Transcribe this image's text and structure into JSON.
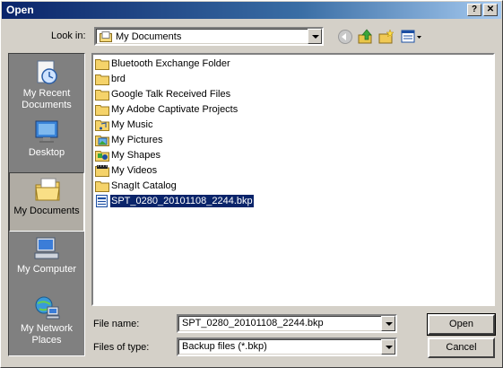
{
  "window": {
    "title": "Open",
    "help_label": "?",
    "close_label": "✕"
  },
  "toolbar": {
    "look_in_label": "Look in:",
    "look_in_value": "My Documents",
    "icons": [
      "back-icon",
      "up-folder-icon",
      "new-folder-icon",
      "view-menu-icon"
    ]
  },
  "places": [
    {
      "label": "My Recent Documents",
      "icon": "recent-documents-icon"
    },
    {
      "label": "Desktop",
      "icon": "desktop-icon"
    },
    {
      "label": "My Documents",
      "icon": "my-documents-icon",
      "selected": true
    },
    {
      "label": "My Computer",
      "icon": "my-computer-icon"
    },
    {
      "label": "My Network Places",
      "icon": "network-places-icon"
    }
  ],
  "files": [
    {
      "name": "Bluetooth Exchange Folder",
      "icon": "folder-icon"
    },
    {
      "name": "brd",
      "icon": "folder-icon"
    },
    {
      "name": "Google Talk Received Files",
      "icon": "folder-icon"
    },
    {
      "name": "My Adobe Captivate Projects",
      "icon": "folder-icon"
    },
    {
      "name": "My Music",
      "icon": "music-folder-icon"
    },
    {
      "name": "My Pictures",
      "icon": "pictures-folder-icon"
    },
    {
      "name": "My Shapes",
      "icon": "shapes-folder-icon"
    },
    {
      "name": "My Videos",
      "icon": "videos-folder-icon"
    },
    {
      "name": "SnagIt Catalog",
      "icon": "folder-icon"
    },
    {
      "name": "SPT_0280_20101108_2244.bkp",
      "icon": "file-icon",
      "selected": true
    }
  ],
  "footer": {
    "file_name_label": "File name:",
    "file_name_value": "SPT_0280_20101108_2244.bkp",
    "file_type_label": "Files of type:",
    "file_type_value": "Backup files (*.bkp)",
    "open_label": "Open",
    "cancel_label": "Cancel"
  }
}
